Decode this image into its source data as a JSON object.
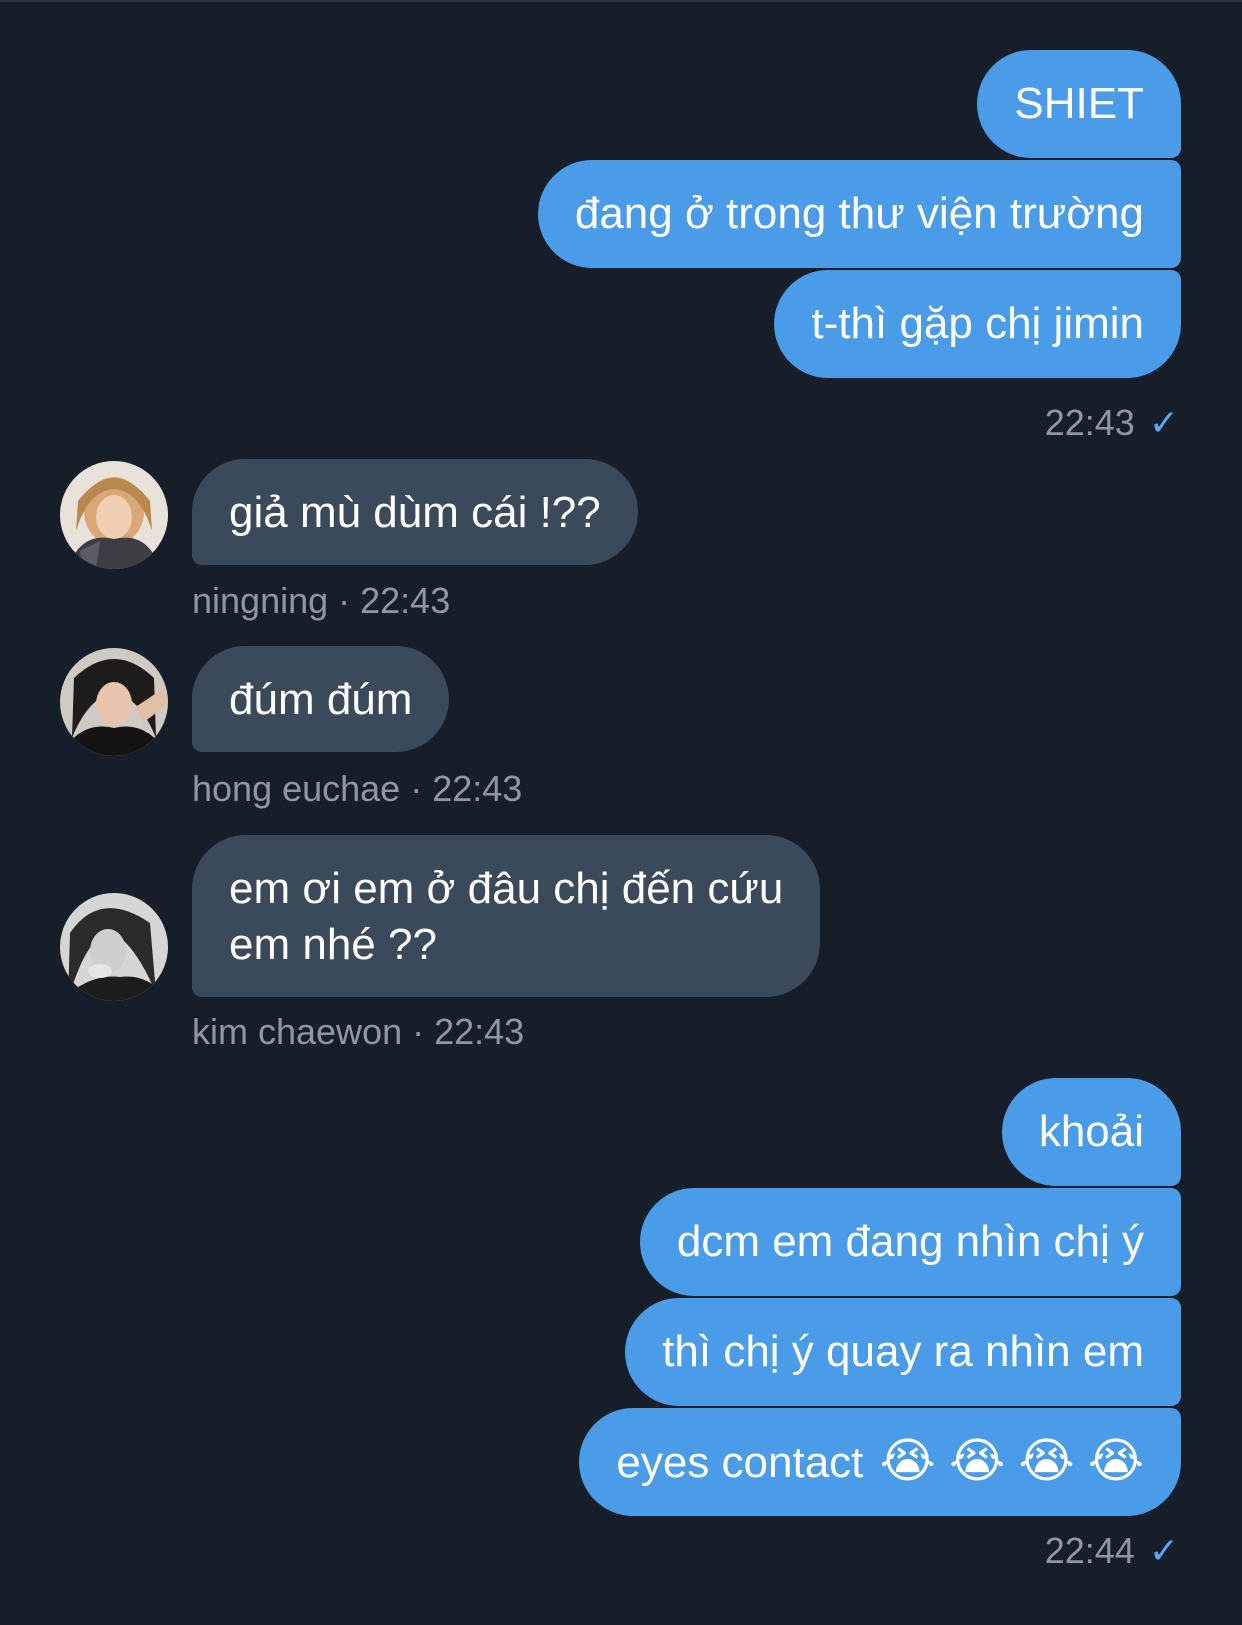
{
  "messages_out_1": [
    {
      "text": "SHIET"
    },
    {
      "text": "đang ở trong thư viện trường"
    },
    {
      "text": "t-thì gặp chị jimin"
    }
  ],
  "out_1_time": "22:43",
  "incoming": [
    {
      "text": "giả mù dùm cái !??",
      "name": "ningning",
      "time": "22:43"
    },
    {
      "text": "đúm đúm",
      "name": "hong euchae",
      "time": "22:43"
    },
    {
      "text_line1": "em ơi em ở đâu chị đến cứu",
      "text_line2": "em nhé ??",
      "name": "kim chaewon",
      "time": "22:43"
    }
  ],
  "messages_out_2": [
    {
      "text": "khoải"
    },
    {
      "text": "dcm em đang nhìn chị ý"
    },
    {
      "text": "thì chị ý quay ra nhìn em"
    },
    {
      "text": "eyes contact",
      "emojis": "😭 😭 😭 😭"
    }
  ],
  "out_2_time": "22:44",
  "meta_separator": " · ",
  "check_icon": "✓",
  "colors": {
    "background": "#161e2a",
    "outgoing_bubble": "#4a9be8",
    "incoming_bubble": "#3a4a5b",
    "meta_text": "#9097a3"
  }
}
